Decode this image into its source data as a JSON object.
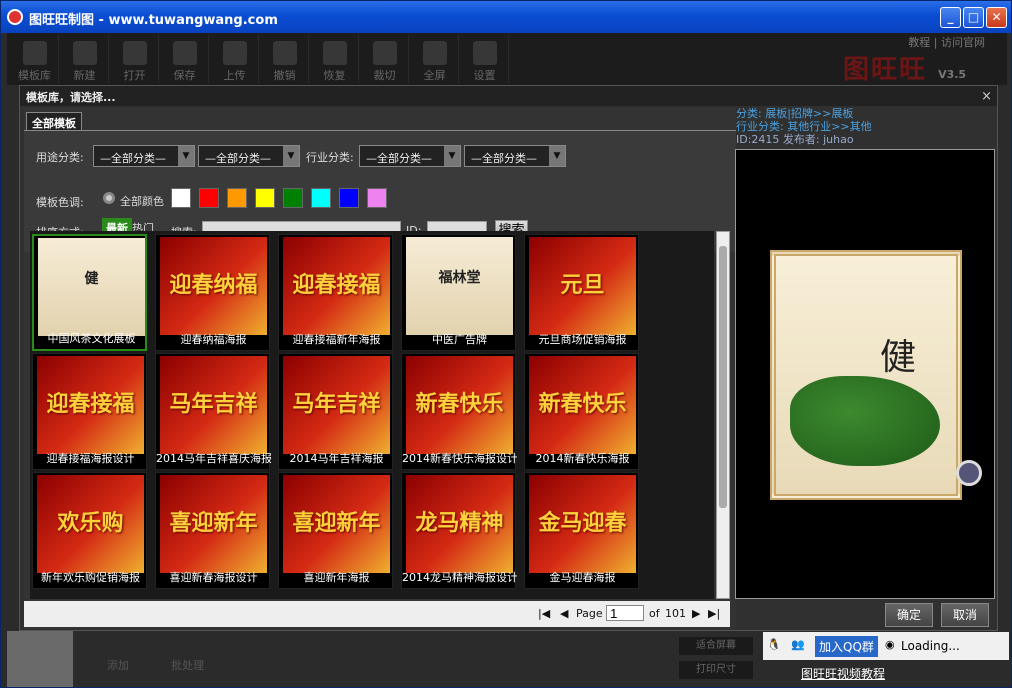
{
  "window": {
    "title": "图旺旺制图 - www.tuwangwang.com",
    "min": "_",
    "max": "□",
    "close": "✕"
  },
  "toolbar": {
    "items": [
      "模板库",
      "新建",
      "打开",
      "保存",
      "上传",
      "撤销",
      "恢复",
      "裁切",
      "全屏",
      "设置"
    ]
  },
  "toplinks": {
    "tutorial": "教程",
    "sep": "|",
    "official": "访问官网"
  },
  "logo": {
    "name": "图旺旺",
    "version": "V3.5"
  },
  "dialog": {
    "title": "模板库，请选择...",
    "close": "×",
    "tab": "全部模板",
    "usage_label": "用途分类:",
    "usage_sel1": "—全部分类—",
    "usage_sel2": "—全部分类—",
    "industry_label": "行业分类:",
    "industry_sel1": "—全部分类—",
    "industry_sel2": "—全部分类—",
    "color_label": "模板色调:",
    "color_all": "全部颜色",
    "colors": [
      "#ffffff",
      "#ff0000",
      "#ff9900",
      "#ffff00",
      "#008000",
      "#00ffff",
      "#0000ff",
      "#ee82ee"
    ],
    "sort_label": "排序方式:",
    "sort_new": "最新",
    "sort_hot": "热门",
    "search_label": "搜索:",
    "id_label": "ID:",
    "search_btn": "搜索",
    "templates": [
      {
        "name": "中国风茶文化展板",
        "art": "健"
      },
      {
        "name": "迎春纳福海报",
        "art": "迎春纳福"
      },
      {
        "name": "迎春接福新年海报",
        "art": "迎春接福"
      },
      {
        "name": "中医广告牌",
        "art": "福林堂"
      },
      {
        "name": "元旦商场促销海报",
        "art": "元旦"
      },
      {
        "name": "迎春接福海报设计",
        "art": "迎春接福"
      },
      {
        "name": "2014马年吉祥喜庆海报",
        "art": "马年吉祥"
      },
      {
        "name": "2014马年吉祥海报",
        "art": "马年吉祥"
      },
      {
        "name": "2014新春快乐海报设计",
        "art": "新春快乐"
      },
      {
        "name": "2014新春快乐海报",
        "art": "新春快乐"
      },
      {
        "name": "新年欢乐购促销海报",
        "art": "欢乐购"
      },
      {
        "name": "喜迎新春海报设计",
        "art": "喜迎新年"
      },
      {
        "name": "喜迎新年海报",
        "art": "喜迎新年"
      },
      {
        "name": "2014龙马精神海报设计",
        "art": "龙马精神"
      },
      {
        "name": "金马迎春海报",
        "art": "金马迎春"
      }
    ],
    "pager": {
      "page_label": "Page",
      "page": "1",
      "of_label": "of",
      "total": "101"
    }
  },
  "right": {
    "category": "分类: 展板|招牌>>展板",
    "industry": "行业分类: 其他行业>>其他",
    "id_line": "ID:2415    发布者: juhao",
    "confirm": "确定",
    "cancel": "取消"
  },
  "bottom": {
    "add": "添加",
    "batch": "批处理",
    "fit_screen": "适合屏幕",
    "print_size": "打印尺寸"
  },
  "qq": {
    "join": "加入QQ群",
    "loading": "Loading...",
    "video": "图旺旺视频教程"
  }
}
